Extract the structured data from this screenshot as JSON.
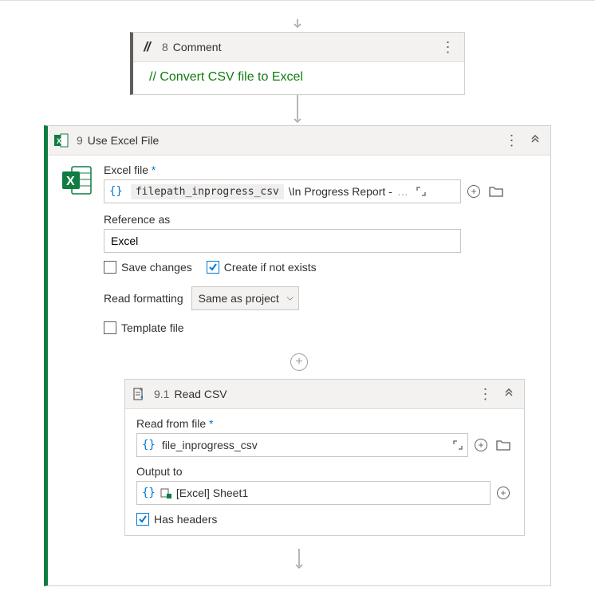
{
  "step_comment": {
    "number": "8",
    "title": "Comment",
    "text": "// Convert CSV file to Excel"
  },
  "step_excel": {
    "number": "9",
    "title": "Use Excel File",
    "fields": {
      "excel_file_label": "Excel file",
      "path_variable": "filepath_inprogress_csv",
      "path_suffix": "\\In Progress Report -",
      "ellipsis": "…",
      "reference_as_label": "Reference as",
      "reference_as_value": "Excel",
      "save_changes_label": "Save changes",
      "save_changes_checked": false,
      "create_if_label": "Create if not exists",
      "create_if_checked": true,
      "read_formatting_label": "Read formatting",
      "read_formatting_value": "Same as project",
      "template_file_label": "Template file",
      "template_file_checked": false
    }
  },
  "step_readcsv": {
    "number": "9.1",
    "title": "Read CSV",
    "fields": {
      "read_from_label": "Read from file",
      "file_variable": "file_inprogress_csv",
      "output_to_label": "Output to",
      "output_ref": "[Excel] Sheet1",
      "has_headers_label": "Has headers",
      "has_headers_checked": true
    }
  }
}
